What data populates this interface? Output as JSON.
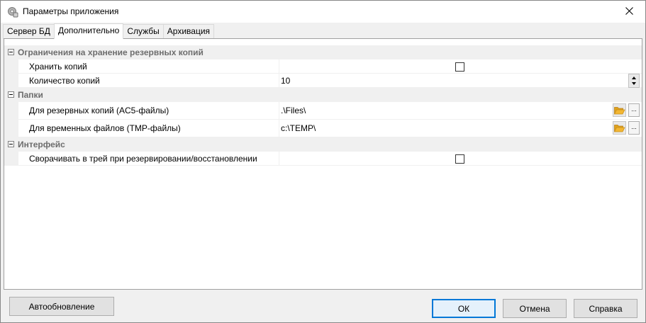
{
  "window": {
    "title": "Параметры приложения"
  },
  "tabs": [
    {
      "label": "Сервер БД",
      "active": false
    },
    {
      "label": "Дополнительно",
      "active": true
    },
    {
      "label": "Службы",
      "active": false
    },
    {
      "label": "Архивация",
      "active": false
    }
  ],
  "categories": {
    "backup_limits": {
      "label": "Ограничения на хранение резервных копий",
      "props": {
        "keep_copies": {
          "name": "Хранить копий",
          "checked": false
        },
        "copy_count": {
          "name": "Количество копий",
          "value": "10"
        }
      }
    },
    "folders": {
      "label": "Папки",
      "props": {
        "backup_dir": {
          "name": "Для резервных копий (AC5-файлы)",
          "value": ".\\Files\\"
        },
        "temp_dir": {
          "name": "Для временных файлов (TMP-файлы)",
          "value": "c:\\TEMP\\"
        }
      }
    },
    "interface": {
      "label": "Интерфейс",
      "props": {
        "minimize_tray": {
          "name": "Сворачивать в трей при резервировании/восстановлении",
          "checked": false
        }
      }
    }
  },
  "ellipsis": "...",
  "buttons": {
    "autoupdate": "Автообновление",
    "ok": "ОК",
    "cancel": "Отмена",
    "help": "Справка"
  },
  "colors": {
    "accent": "#0078d7",
    "category_bg": "#f0f0f0",
    "folder_icon": "#f3b632"
  }
}
